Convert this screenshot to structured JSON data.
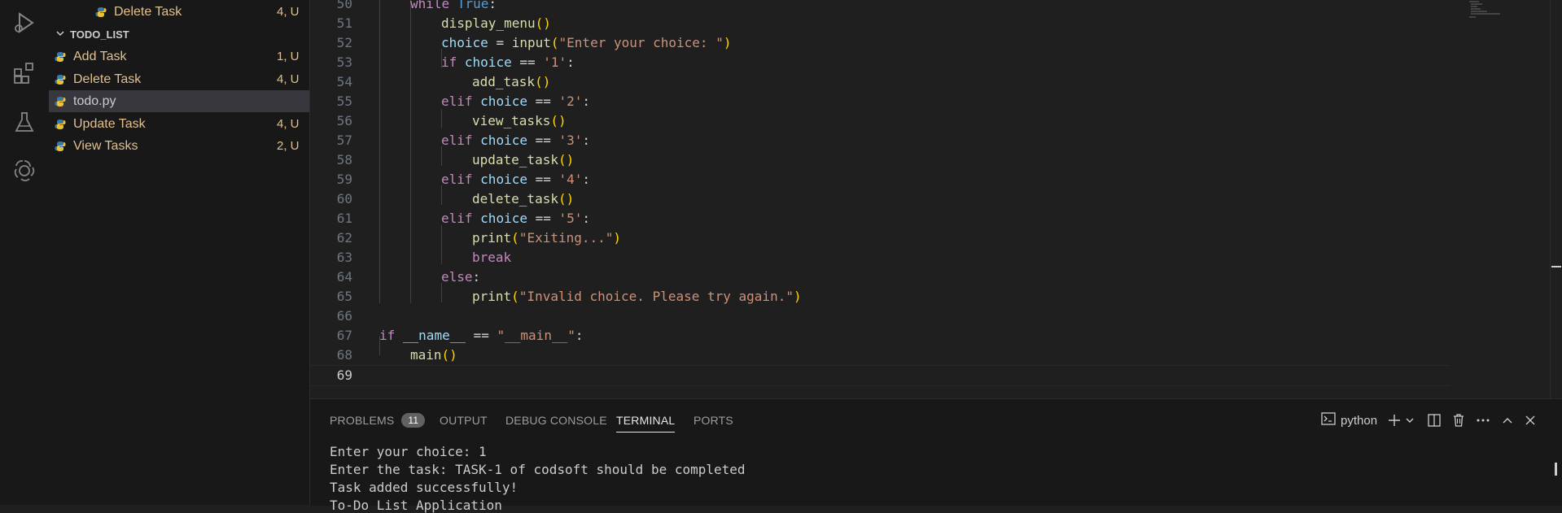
{
  "explorer": {
    "top_item": {
      "label": "Delete Task",
      "status": "4, U"
    },
    "section_title": "TODO_LIST",
    "items": [
      {
        "label": "Add Task",
        "status": "1, U"
      },
      {
        "label": "Delete Task",
        "status": "4, U"
      },
      {
        "label": "todo.py",
        "status": ""
      },
      {
        "label": "Update Task",
        "status": "4, U"
      },
      {
        "label": "View Tasks",
        "status": "2, U"
      }
    ]
  },
  "editor": {
    "line_numbers": [
      "50",
      "51",
      "52",
      "53",
      "54",
      "55",
      "56",
      "57",
      "58",
      "59",
      "60",
      "61",
      "62",
      "63",
      "64",
      "65",
      "66",
      "67",
      "68",
      "69"
    ],
    "active_line": "69"
  },
  "panel": {
    "tabs": {
      "problems": "PROBLEMS",
      "problems_count": "11",
      "output": "OUTPUT",
      "debug_console": "DEBUG CONSOLE",
      "terminal": "TERMINAL",
      "ports": "PORTS"
    },
    "terminal_name": "python",
    "terminal_lines": [
      "Enter your choice: 1",
      "Enter the task: TASK-1 of codsoft should be completed",
      "Task added successfully!",
      "To-Do List Application"
    ]
  },
  "colors": {
    "modified": "#e2c08d",
    "keyword": "#c586c0",
    "function": "#dcdcaa",
    "string": "#ce9178",
    "variable": "#9cdcfe",
    "bracket": "#ffd700"
  }
}
